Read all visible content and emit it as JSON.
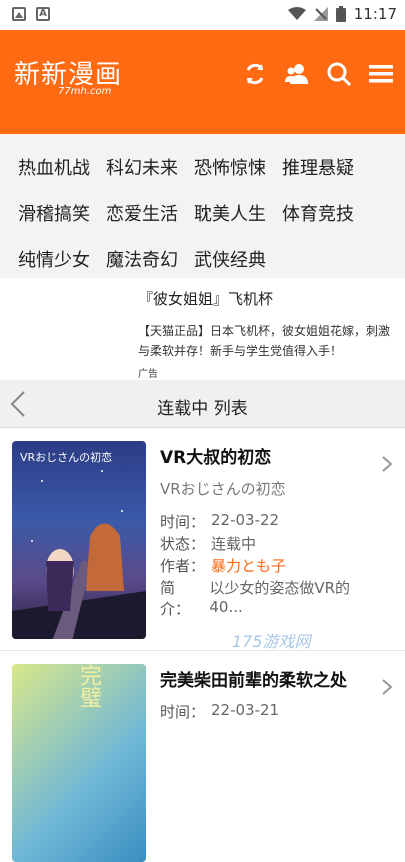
{
  "status": {
    "time": "11:17"
  },
  "header": {
    "logo_main": "新新漫画",
    "logo_sub": "77mh.com",
    "icons": [
      "refresh-icon",
      "user-icon",
      "search-icon",
      "menu-icon"
    ],
    "accent_color": "#ff6a13"
  },
  "categories": [
    [
      "热血机战",
      "科幻未来",
      "恐怖惊悚",
      "推理悬疑"
    ],
    [
      "滑稽搞笑",
      "恋爱生活",
      "耽美人生",
      "体育竞技"
    ],
    [
      "纯情少女",
      "魔法奇幻",
      "武侠经典"
    ]
  ],
  "ad": {
    "title": "『彼女姐姐』飞机杯",
    "desc": "【天猫正品】日本飞机杯，彼女姐姐花嫁，刺激与柔软并存！新手与学生党值得入手！",
    "label": "广告"
  },
  "listbar": {
    "title": "连载中 列表"
  },
  "items": [
    {
      "title": "VR大叔的初恋",
      "subtitle": "VRおじさんの初恋",
      "time_label": "时间：",
      "time": "22-03-22",
      "status_label": "状态：",
      "status": "连载中",
      "author_label": "作者：",
      "author": "暴力とも子",
      "intro_label": "简介：",
      "intro": "以少女的姿态做VR的40...",
      "cover_text": "VRおじさんの初恋"
    },
    {
      "title": "完美柴田前辈的柔软之处",
      "time_label": "时间：",
      "time": "22-03-21",
      "cover_text": "完璧"
    }
  ],
  "watermark": "175游戏网"
}
